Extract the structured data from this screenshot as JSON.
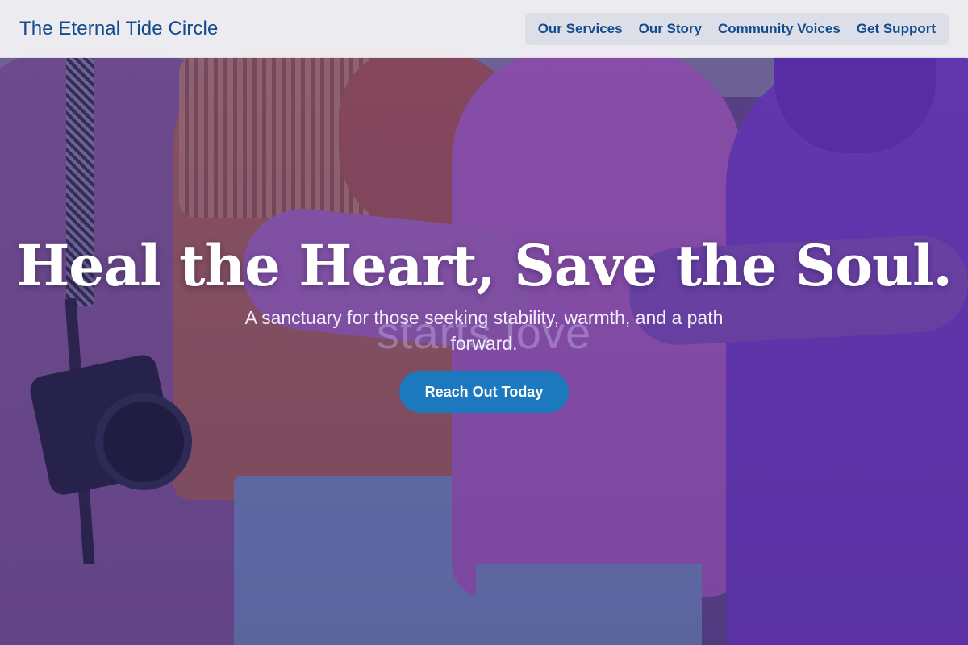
{
  "header": {
    "brand": "The Eternal Tide Circle",
    "nav": [
      {
        "label": "Our Services"
      },
      {
        "label": "Our Story"
      },
      {
        "label": "Community Voices"
      },
      {
        "label": "Get Support"
      }
    ]
  },
  "hero": {
    "headline": "Heal the Heart, Save the Soul.",
    "subtitle": "A sanctuary for those seeking stability, warmth, and a path forward.",
    "background_text": "starts love",
    "cta_label": "Reach Out Today",
    "image_description": "group-hugging-photo"
  },
  "colors": {
    "brand": "#134b8e",
    "cta": "#1d79bd",
    "overlay": "#3a2878"
  }
}
